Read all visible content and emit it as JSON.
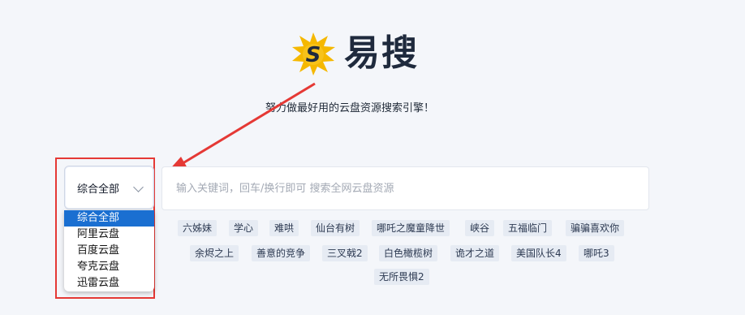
{
  "brand": {
    "name": "易搜",
    "logo_icon": "lightning-s-logo-icon",
    "tagline": "努力做最好用的云盘资源搜索引擎！"
  },
  "category_select": {
    "selected_label": "综合全部",
    "options": [
      "综合全部",
      "阿里云盘",
      "百度云盘",
      "夸克云盘",
      "迅雷云盘"
    ],
    "selected_index": 0
  },
  "search": {
    "value": "",
    "placeholder": "输入关键词，回车/换行即可 搜索全网云盘资源"
  },
  "hot_tags": [
    "六姊妹",
    "学心",
    "难哄",
    "仙台有树",
    "哪吒之魔童降世",
    "峡谷",
    "五福临门",
    "骗骗喜欢你",
    "余烬之上",
    "善意的竞争",
    "三叉戟2",
    "白色橄榄树",
    "诡才之道",
    "美国队长4",
    "哪吒3",
    "无所畏惧2"
  ],
  "annotation": {
    "color": "#e53935"
  },
  "colors": {
    "background": "#f4f6fa",
    "accent_selected": "#1a6fd1",
    "tag_bg": "#e6ebf3",
    "logo_yellow": "#f5b800"
  }
}
